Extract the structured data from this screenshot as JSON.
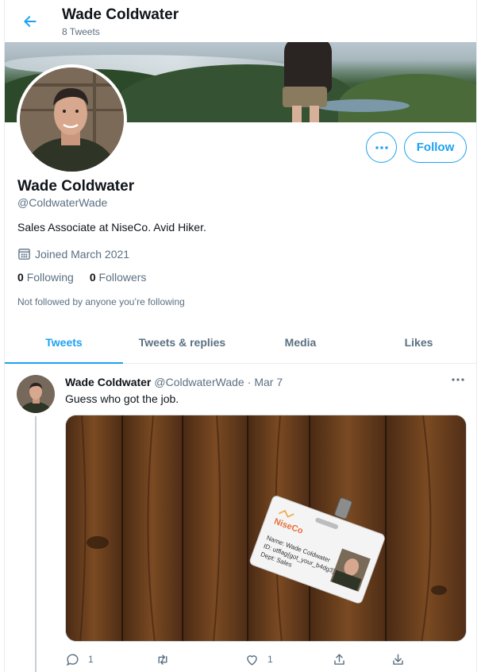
{
  "header": {
    "name": "Wade Coldwater",
    "tweet_count": "8 Tweets"
  },
  "profile": {
    "name": "Wade Coldwater",
    "handle": "@ColdwaterWade",
    "bio": "Sales Associate at NiseCo. Avid Hiker.",
    "joined": "Joined March 2021",
    "following_count": "0",
    "following_label": "Following",
    "followers_count": "0",
    "followers_label": "Followers",
    "followed_note": "Not followed by anyone you’re following",
    "follow_button": "Follow"
  },
  "tabs": [
    {
      "label": "Tweets",
      "active": true
    },
    {
      "label": "Tweets & replies",
      "active": false
    },
    {
      "label": "Media",
      "active": false
    },
    {
      "label": "Likes",
      "active": false
    }
  ],
  "tweet": {
    "author": "Wade Coldwater",
    "handle": "@ColdwaterWade",
    "separator": "·",
    "date": "Mar 7",
    "text": "Guess who got the job.",
    "reply_count": "1",
    "like_count": "1",
    "badge": {
      "brand": "NiseCo",
      "line1": "Name: Wade Coldwater",
      "line2": "ID: utflag{got_your_b4dg3}",
      "line3": "Dept: Sales"
    }
  },
  "colors": {
    "accent": "#1da1f2",
    "secondary_text": "#5b7083"
  },
  "icons": [
    "back-arrow-icon",
    "more-icon",
    "calendar-icon",
    "reply-icon",
    "retweet-icon",
    "like-icon",
    "share-icon",
    "download-icon"
  ]
}
